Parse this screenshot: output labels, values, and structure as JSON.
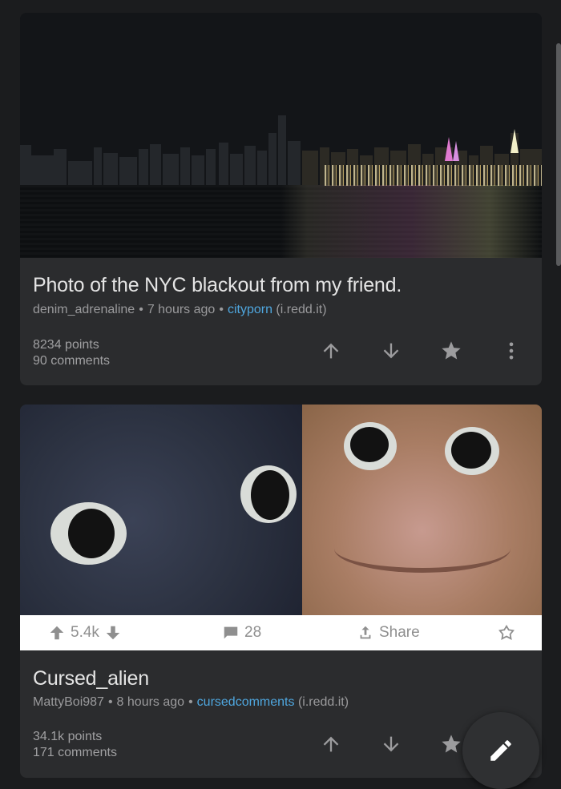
{
  "posts": [
    {
      "title": "Photo of the NYC blackout from my friend.",
      "author": "denim_adrenaline",
      "time": "7 hours ago",
      "subreddit": "cityporn",
      "domain": "(i.redd.it)",
      "points": "8234 points",
      "comments": "90 comments"
    },
    {
      "title": "Cursed_alien",
      "author": "MattyBoi987",
      "time": "8 hours ago",
      "subreddit": "cursedcomments",
      "domain": "(i.redd.it)",
      "points": "34.1k points",
      "comments": "171 comments",
      "embedded_bar": {
        "score": "5.4k",
        "comments": "28",
        "share": "Share"
      }
    }
  ],
  "separator": "•",
  "icons": {
    "upvote": "arrow-up-icon",
    "downvote": "arrow-down-icon",
    "save": "star-icon",
    "more": "more-vert-icon",
    "fab": "pencil-icon"
  },
  "colors": {
    "background": "#1b1c1e",
    "card": "#2b2c2e",
    "subreddit_link": "#4fa7df"
  }
}
